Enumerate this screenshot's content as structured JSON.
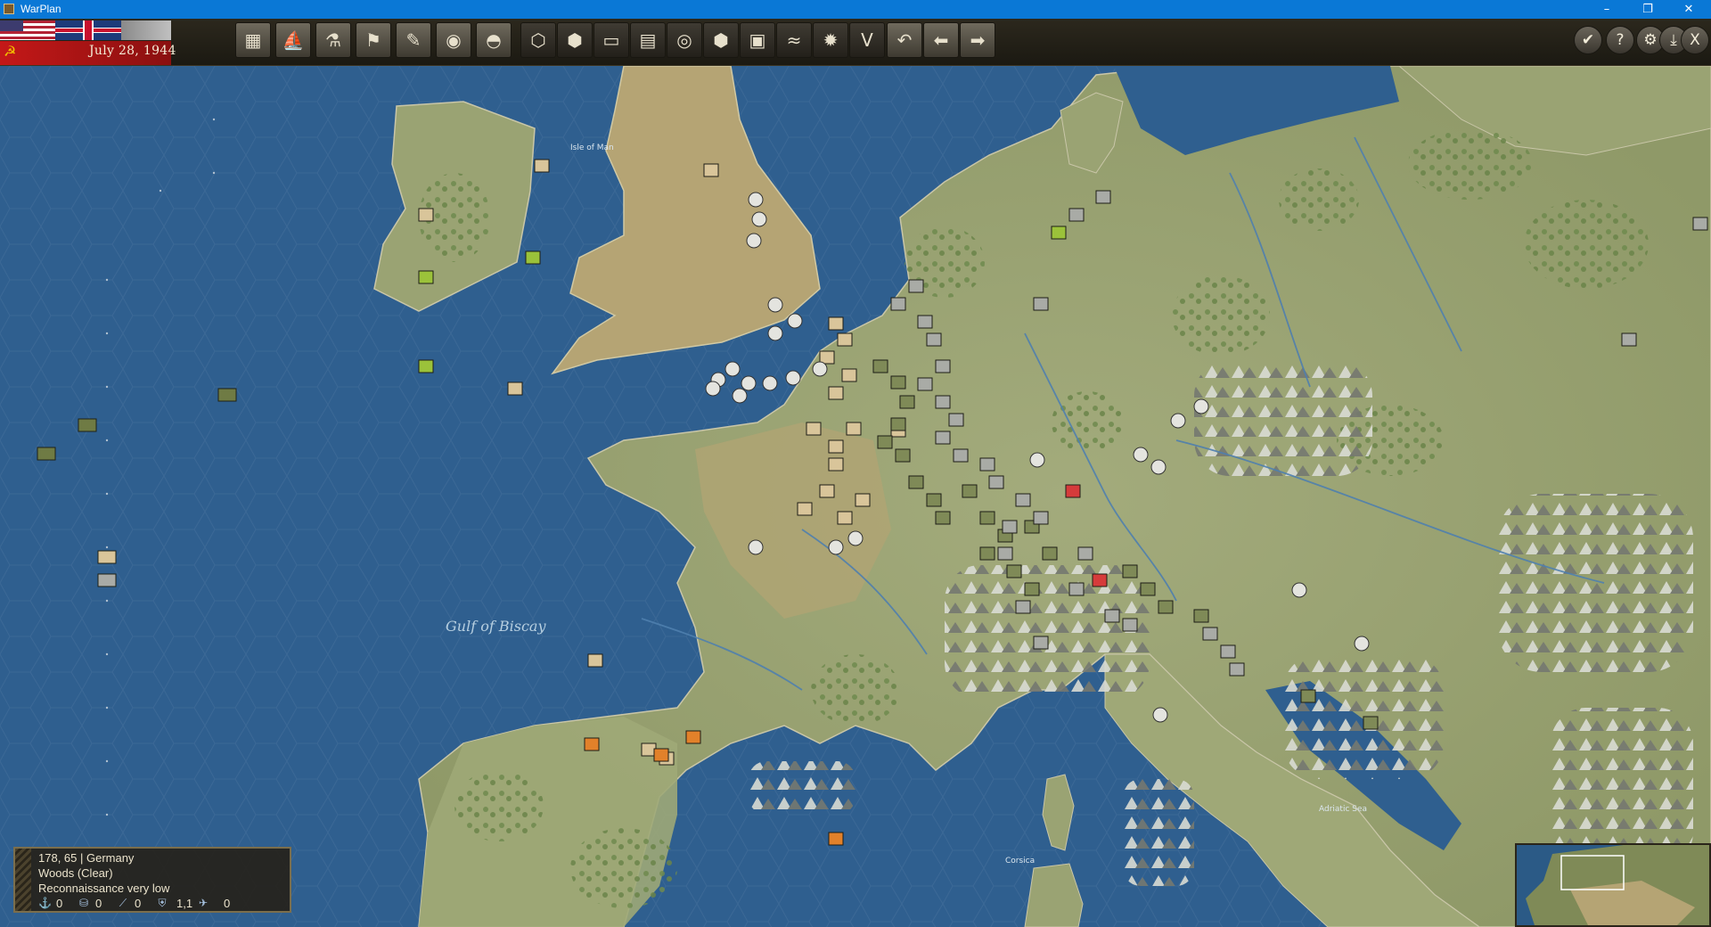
{
  "window": {
    "title": "WarPlan",
    "controls": {
      "minimize": "–",
      "maximize": "❐",
      "close": "✕"
    }
  },
  "header": {
    "date": "July 28, 1944"
  },
  "toolbar": {
    "left_buttons": [
      {
        "name": "production",
        "icon": "▦"
      },
      {
        "name": "naval",
        "icon": "⛵"
      },
      {
        "name": "research",
        "icon": "⚗"
      },
      {
        "name": "diplomacy-flag",
        "icon": "⚑"
      },
      {
        "name": "reports",
        "icon": "✎"
      },
      {
        "name": "intelligence",
        "icon": "◉"
      },
      {
        "name": "helmet",
        "icon": "◓"
      }
    ],
    "map_buttons": [
      {
        "name": "hex-grid",
        "icon": "⬡"
      },
      {
        "name": "supply",
        "icon": "⬢"
      },
      {
        "name": "vehicle",
        "icon": "▭"
      },
      {
        "name": "units-stack",
        "icon": "▤"
      },
      {
        "name": "target",
        "icon": "◎"
      },
      {
        "name": "gear-hex",
        "icon": "⬢"
      },
      {
        "name": "convoy",
        "icon": "▣"
      },
      {
        "name": "weather",
        "icon": "≈"
      },
      {
        "name": "explosion",
        "icon": "✹"
      },
      {
        "name": "victory",
        "icon": "V"
      },
      {
        "name": "undo",
        "icon": "↶"
      },
      {
        "name": "previous",
        "icon": "⬅"
      },
      {
        "name": "next",
        "icon": "➡"
      }
    ],
    "right_buttons": [
      {
        "name": "end-turn",
        "icon": "✔"
      },
      {
        "name": "help",
        "icon": "?"
      },
      {
        "name": "settings",
        "icon": "⚙"
      },
      {
        "name": "save",
        "icon": "⤓"
      },
      {
        "name": "exit",
        "icon": "X"
      }
    ]
  },
  "map": {
    "labels": {
      "gulf_of_biscay": "Gulf of Biscay",
      "isle_of_man": "Isle of Man",
      "corsica": "Corsica",
      "adriatic": "Adriatic Sea"
    },
    "colors": {
      "sea": "#2f5f8f",
      "land": "#9aa373",
      "land_dry": "#b5a474",
      "mountain": "#8a8c80",
      "allied_unit": "#d9c59a",
      "german_unit": "#7f8a57",
      "axis_grey": "#a9aba6"
    }
  },
  "info_panel": {
    "location": "178, 65 | Germany",
    "terrain": "Woods (Clear)",
    "recon": "Reconnaissance very low",
    "stats": [
      {
        "icon": "anchor-icon",
        "value": "0"
      },
      {
        "icon": "supply-icon",
        "value": "0"
      },
      {
        "icon": "artillery-icon",
        "value": "0"
      },
      {
        "icon": "shield-icon",
        "value": "1,1"
      },
      {
        "icon": "aircraft-icon",
        "value": "0"
      }
    ]
  }
}
